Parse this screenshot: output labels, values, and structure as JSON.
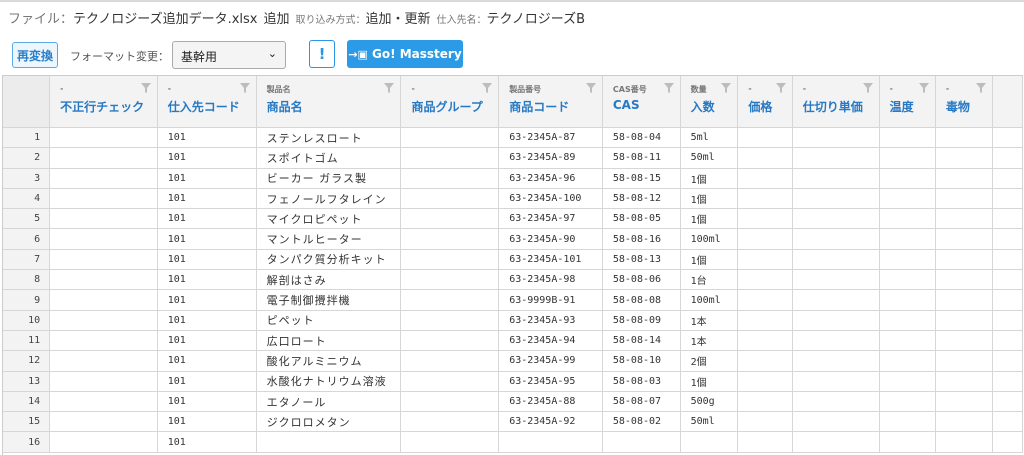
{
  "info": {
    "file_label": "ファイル：",
    "file_name": "テクノロジーズ追加データ.xlsx",
    "file_mode": "追加",
    "import_label": "取り込み方式：",
    "import_value": "追加・更新",
    "supplier_label": "仕入先名：",
    "supplier_value": "テクノロジーズB"
  },
  "toolbar": {
    "reconvert_label": "再変換",
    "format_label": "フォーマット変更：",
    "format_value": "基幹用",
    "warning_label": "!",
    "go_label": "Go! Masstery"
  },
  "columns": [
    {
      "sub": "-",
      "main": "不正行チェック"
    },
    {
      "sub": "-",
      "main": "仕入先コード"
    },
    {
      "sub": "製品名",
      "main": "商品名"
    },
    {
      "sub": "-",
      "main": "商品グループ"
    },
    {
      "sub": "製品番号",
      "main": "商品コード"
    },
    {
      "sub": "CAS番号",
      "main": "CAS"
    },
    {
      "sub": "数量",
      "main": "入数"
    },
    {
      "sub": "-",
      "main": "価格"
    },
    {
      "sub": "-",
      "main": "仕切り単価"
    },
    {
      "sub": "-",
      "main": "温度"
    },
    {
      "sub": "-",
      "main": "毒物"
    }
  ],
  "rows": [
    {
      "n": "1",
      "check": "",
      "supplier": "101",
      "name": "ステンレスロート",
      "group": "",
      "code": "63-2345A-87",
      "cas": "58-08-04",
      "qty": "5ml"
    },
    {
      "n": "2",
      "check": "",
      "supplier": "101",
      "name": "スポイトゴム",
      "group": "",
      "code": "63-2345A-89",
      "cas": "58-08-11",
      "qty": "50ml"
    },
    {
      "n": "3",
      "check": "",
      "supplier": "101",
      "name": "ビーカー ガラス製",
      "group": "",
      "code": "63-2345A-96",
      "cas": "58-08-15",
      "qty": "1個"
    },
    {
      "n": "4",
      "check": "",
      "supplier": "101",
      "name": "フェノールフタレイン",
      "group": "",
      "code": "63-2345A-100",
      "cas": "58-08-12",
      "qty": "1個"
    },
    {
      "n": "5",
      "check": "",
      "supplier": "101",
      "name": "マイクロピペット",
      "group": "",
      "code": "63-2345A-97",
      "cas": "58-08-05",
      "qty": "1個"
    },
    {
      "n": "6",
      "check": "",
      "supplier": "101",
      "name": "マントルヒーター",
      "group": "",
      "code": "63-2345A-90",
      "cas": "58-08-16",
      "qty": "100ml"
    },
    {
      "n": "7",
      "check": "",
      "supplier": "101",
      "name": "タンパク質分析キット",
      "group": "",
      "code": "63-2345A-101",
      "cas": "58-08-13",
      "qty": "1個"
    },
    {
      "n": "8",
      "check": "",
      "supplier": "101",
      "name": "解剖はさみ",
      "group": "",
      "code": "63-2345A-98",
      "cas": "58-08-06",
      "qty": "1台"
    },
    {
      "n": "9",
      "check": "",
      "supplier": "101",
      "name": "電子制御攪拌機",
      "group": "",
      "code": "63-9999B-91",
      "cas": "58-08-08",
      "qty": "100ml"
    },
    {
      "n": "10",
      "check": "",
      "supplier": "101",
      "name": "ピペット",
      "group": "",
      "code": "63-2345A-93",
      "cas": "58-08-09",
      "qty": "1本"
    },
    {
      "n": "11",
      "check": "",
      "supplier": "101",
      "name": "広口ロート",
      "group": "",
      "code": "63-2345A-94",
      "cas": "58-08-14",
      "qty": "1本"
    },
    {
      "n": "12",
      "check": "",
      "supplier": "101",
      "name": "酸化アルミニウム",
      "group": "",
      "code": "63-2345A-99",
      "cas": "58-08-10",
      "qty": "2個"
    },
    {
      "n": "13",
      "check": "",
      "supplier": "101",
      "name": "水酸化ナトリウム溶液",
      "group": "",
      "code": "63-2345A-95",
      "cas": "58-08-03",
      "qty": "1個"
    },
    {
      "n": "14",
      "check": "",
      "supplier": "101",
      "name": "エタノール",
      "group": "",
      "code": "63-2345A-88",
      "cas": "58-08-07",
      "qty": "500g"
    },
    {
      "n": "15",
      "check": "",
      "supplier": "101",
      "name": "ジクロロメタン",
      "group": "",
      "code": "63-2345A-92",
      "cas": "58-08-02",
      "qty": "50ml"
    },
    {
      "n": "16",
      "check": "",
      "supplier": "101",
      "name": "",
      "group": "",
      "code": "",
      "cas": "",
      "qty": ""
    }
  ],
  "colors": {
    "accent": "#2779c4",
    "button": "#2b9be8",
    "header_bg": "#f3f3f3",
    "grid": "#d6d6d6"
  }
}
